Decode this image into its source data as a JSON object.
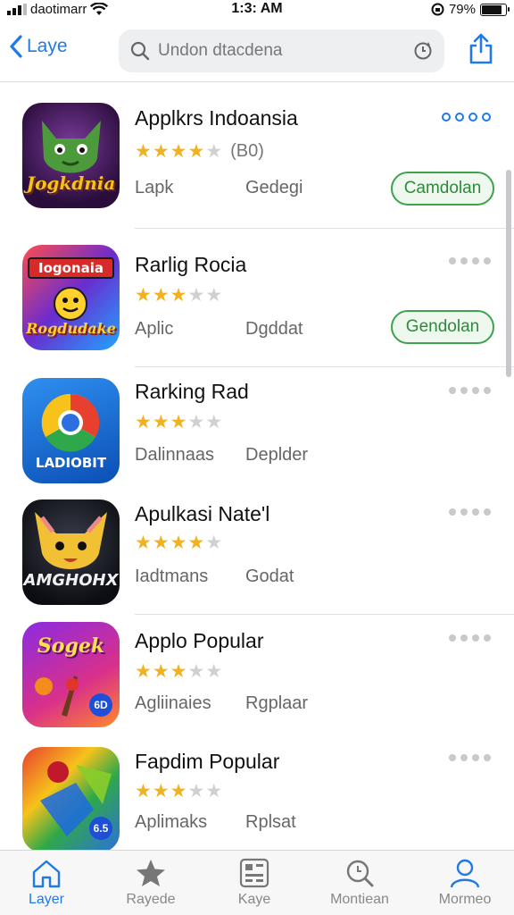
{
  "status_bar": {
    "carrier": "daotimarr",
    "time": "1:3: AM",
    "battery": "79%"
  },
  "nav": {
    "back_label": "Laye",
    "search_placeholder": "Undon dtacdena"
  },
  "apps": [
    {
      "name": "Applkrs Indoansia",
      "icon_text": "Jogkdnia",
      "stars": 4,
      "rating_count": "(B0)",
      "category": "Lapk",
      "subtitle": "Gedegi",
      "button": "Camdolan",
      "menu_style": "blue"
    },
    {
      "name": "Rarlig Rocia",
      "icon_text": "Rogdudake",
      "icon_banner": "Iogonaia",
      "stars": 3,
      "rating_count": "",
      "category": "Aplic",
      "subtitle": "Dgddat",
      "button": "Gendolan",
      "menu_style": "gray"
    },
    {
      "name": "Rarking Rad",
      "icon_text": "LADIOBIT",
      "stars": 3,
      "rating_count": "",
      "category": "Dalinnaas",
      "subtitle": "Deplder",
      "button": "",
      "menu_style": "gray"
    },
    {
      "name": "Apulkasi Nate'l",
      "icon_text": "AMGHOHX",
      "stars": 4,
      "rating_count": "",
      "category": "Iadtmans",
      "subtitle": "Godat",
      "button": "",
      "menu_style": "gray"
    },
    {
      "name": "Applo Popular",
      "icon_text": "Sogek",
      "icon_badge": "6D",
      "stars": 3,
      "rating_count": "",
      "category": "Agliinaies",
      "subtitle": "Rgplaar",
      "button": "",
      "menu_style": "gray"
    },
    {
      "name": "Fapdim Popular",
      "icon_text": "",
      "icon_badge": "6.5",
      "stars": 3,
      "rating_count": "",
      "category": "Aplimaks",
      "subtitle": "Rplsat",
      "button": "",
      "menu_style": "gray"
    }
  ],
  "tabs": [
    {
      "label": "Layer",
      "icon": "home-icon",
      "active": true
    },
    {
      "label": "Rayede",
      "icon": "star-icon",
      "active": false
    },
    {
      "label": "Kaye",
      "icon": "apps-icon",
      "active": false
    },
    {
      "label": "Montiean",
      "icon": "search-icon",
      "active": false
    },
    {
      "label": "Mormeo",
      "icon": "profile-icon",
      "active": false
    }
  ],
  "colors": {
    "accent": "#1f7ae8",
    "star": "#f2b21f",
    "get_button": "#3fa34d"
  }
}
